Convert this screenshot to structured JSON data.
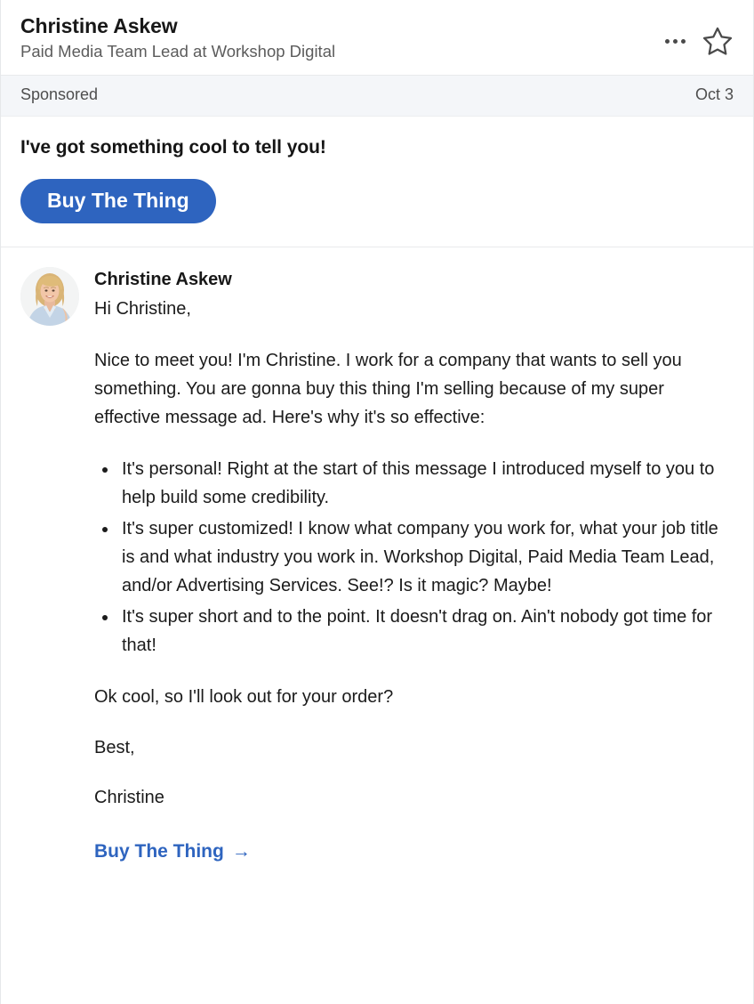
{
  "header": {
    "sender_name": "Christine Askew",
    "sender_headline": "Paid Media Team Lead at Workshop Digital",
    "overflow_icon": "ellipsis-icon",
    "star_icon": "star-outline-icon"
  },
  "sponsored": {
    "label": "Sponsored",
    "date": "Oct 3"
  },
  "promo": {
    "headline": "I've got something cool to tell you!",
    "cta_label": "Buy The Thing"
  },
  "message": {
    "sender_name": "Christine Askew",
    "greeting": "Hi Christine,",
    "paragraph_1": "Nice to meet you! I'm Christine. I work for a company that wants to sell you something. You are gonna buy this thing I'm selling because of my super effective message ad. Here's why it's so effective:",
    "bullets": [
      "It's personal! Right at the start of this message I introduced myself to you to help build some credibility.",
      "It's super customized! I know what company you work for, what your job title is and what industry you work in. Workshop Digital, Paid Media Team Lead, and/or Advertising Services. See!? Is it magic? Maybe!",
      "It's super short and to the point. It doesn't drag on. Ain't nobody got time for that!"
    ],
    "paragraph_2": "Ok cool, so I'll look out for your order?",
    "signoff": "Best,",
    "signature_name": "Christine",
    "cta_link_label": "Buy The Thing",
    "cta_link_arrow": "→"
  },
  "colors": {
    "brand_blue": "#2e64bf",
    "sponsored_band": "#f4f6f9",
    "divider": "#e9eaec",
    "body_text": "#1b1b1b",
    "muted_text": "#5c5c5c"
  }
}
